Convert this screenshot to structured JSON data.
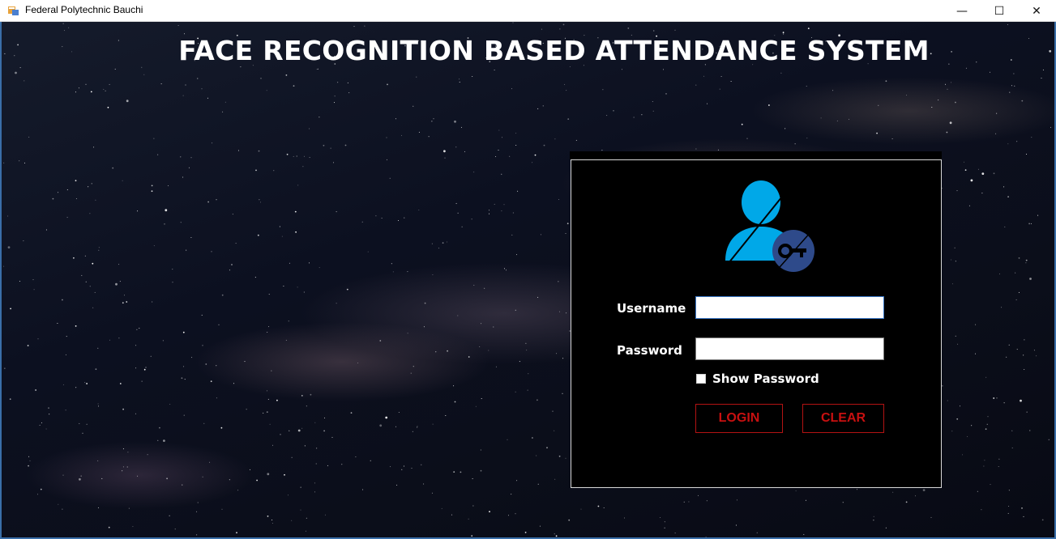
{
  "window": {
    "title": "Federal Polytechnic Bauchi",
    "controls": {
      "minimize": "—",
      "maximize": "☐",
      "close": "✕"
    }
  },
  "page": {
    "title": "FACE RECOGNITION BASED ATTENDANCE SYSTEM"
  },
  "login": {
    "icon": "user-key-icon",
    "username_label": "Username",
    "username_value": "",
    "password_label": "Password",
    "password_value": "",
    "show_password_label": "Show Password",
    "show_password_checked": false,
    "login_label": "LOGIN",
    "clear_label": "CLEAR"
  },
  "colors": {
    "icon_blue": "#00a8e8",
    "key_badge": "#2e4a8a",
    "button_text": "#c81010",
    "panel_bg": "#000000"
  }
}
